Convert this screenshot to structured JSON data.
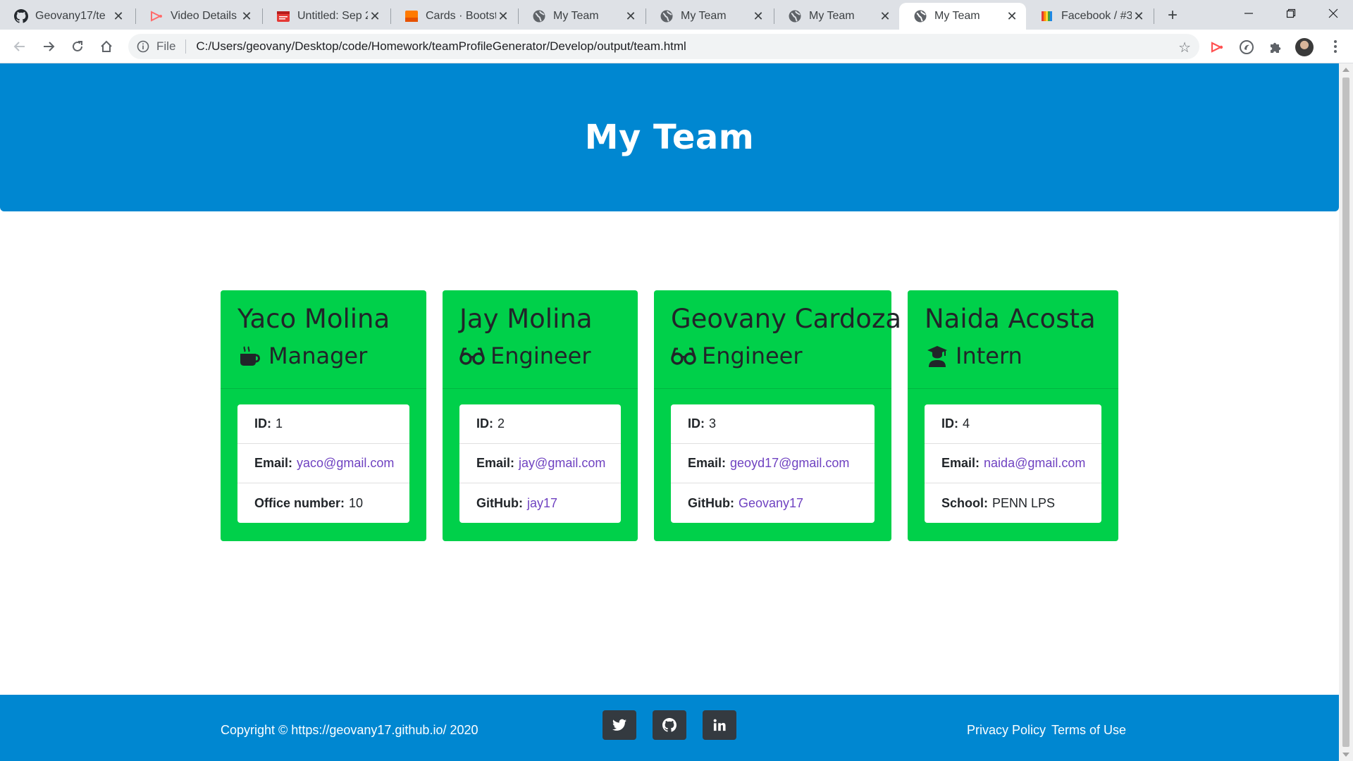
{
  "browser": {
    "tabs": [
      {
        "title": "Geovany17/te",
        "icon": "github-icon",
        "active": false
      },
      {
        "title": "Video Details -",
        "icon": "video-icon",
        "active": false
      },
      {
        "title": "Untitled: Sep 2",
        "icon": "clapperboard-icon",
        "active": false
      },
      {
        "title": "Cards · Bootstr",
        "icon": "bootstrap-icon",
        "active": false
      },
      {
        "title": "My Team",
        "icon": "globe-icon",
        "active": false
      },
      {
        "title": "My Team",
        "icon": "globe-icon",
        "active": false
      },
      {
        "title": "My Team",
        "icon": "globe-icon",
        "active": false
      },
      {
        "title": "My Team",
        "icon": "globe-icon",
        "active": true
      },
      {
        "title": "Facebook / #3",
        "icon": "rainbow-icon",
        "active": false
      }
    ],
    "new_tab_label": "+",
    "address": {
      "scheme_label": "File",
      "url": "C:/Users/geovany/Desktop/code/Homework/teamProfileGenerator/Develop/output/team.html"
    }
  },
  "page": {
    "header_title": "My Team",
    "cards": [
      {
        "name": "Yaco Molina",
        "role": "Manager",
        "role_icon": "coffee-mug-icon",
        "items": [
          {
            "label": "ID:",
            "value": "1",
            "link": false
          },
          {
            "label": "Email:",
            "value": "yaco@gmail.com",
            "link": true
          },
          {
            "label": "Office number:",
            "value": "10",
            "link": false
          }
        ]
      },
      {
        "name": "Jay Molina",
        "role": "Engineer",
        "role_icon": "glasses-icon",
        "items": [
          {
            "label": "ID:",
            "value": "2",
            "link": false
          },
          {
            "label": "Email:",
            "value": "jay@gmail.com",
            "link": true
          },
          {
            "label": "GitHub:",
            "value": "jay17",
            "link": true
          }
        ]
      },
      {
        "name": "Geovany Cardoza",
        "role": "Engineer",
        "role_icon": "glasses-icon",
        "items": [
          {
            "label": "ID:",
            "value": "3",
            "link": false
          },
          {
            "label": "Email:",
            "value": "geoyd17@gmail.com",
            "link": true
          },
          {
            "label": "GitHub:",
            "value": "Geovany17",
            "link": true
          }
        ]
      },
      {
        "name": "Naida Acosta",
        "role": "Intern",
        "role_icon": "graduate-icon",
        "items": [
          {
            "label": "ID:",
            "value": "4",
            "link": false
          },
          {
            "label": "Email:",
            "value": "naida@gmail.com",
            "link": true
          },
          {
            "label": "School:",
            "value": "PENN LPS",
            "link": false
          }
        ]
      }
    ],
    "footer": {
      "copyright": "Copyright © https://geovany17.github.io/ 2020",
      "social": [
        "twitter-icon",
        "github-icon",
        "linkedin-icon"
      ],
      "links": [
        "Privacy Policy",
        "Terms of Use"
      ]
    }
  },
  "colors": {
    "header_blue": "#0087d1",
    "card_green": "#00d04a",
    "link_purple": "#6f42c1",
    "social_dark": "#343a40"
  }
}
